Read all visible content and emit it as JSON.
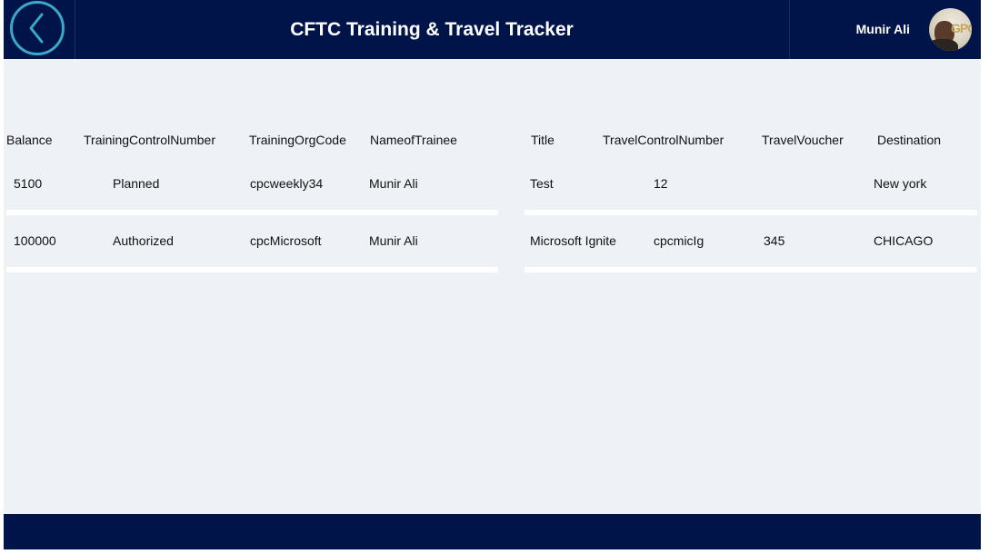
{
  "header": {
    "title": "CFTC Training & Travel Tracker",
    "user_name": "Munir Ali",
    "avatar_text": "GPO"
  },
  "training_table": {
    "columns": [
      "Balance",
      "TrainingControlNumber",
      "TrainingOrgCode",
      "NameofTrainee"
    ],
    "rows": [
      [
        "5100",
        "Planned",
        "cpcweekly34",
        "Munir Ali"
      ],
      [
        "100000",
        "Authorized",
        "cpcMicrosoft",
        "Munir Ali"
      ]
    ]
  },
  "travel_table": {
    "columns": [
      "Title",
      "TravelControlNumber",
      "TravelVoucher",
      "Destination"
    ],
    "rows": [
      [
        "Test",
        "12",
        "",
        "New york"
      ],
      [
        "Microsoft Ignite",
        "cpcmicIg",
        "345",
        "CHICAGO"
      ]
    ]
  },
  "colors": {
    "header_bg": "#001449",
    "page_bg": "#eef2f7",
    "accent": "#3aa8c9"
  },
  "icons": {
    "back": "chevron-left-icon"
  }
}
